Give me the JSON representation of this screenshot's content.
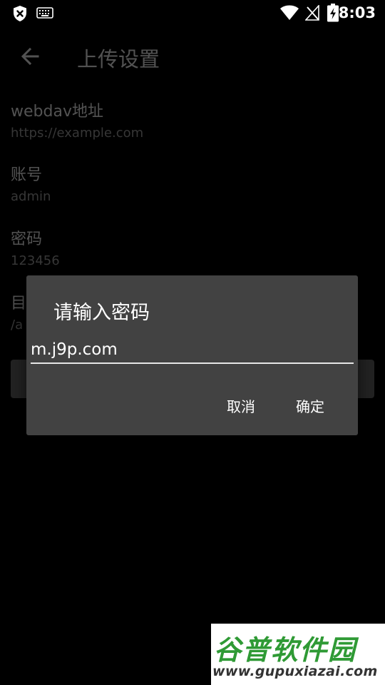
{
  "status_bar": {
    "time": "8:03",
    "icons": [
      "shield-x-icon",
      "keyboard-icon",
      "wifi-icon",
      "no-signal-icon",
      "battery-charging-icon"
    ]
  },
  "toolbar": {
    "back_icon": "arrow-left-icon",
    "title": "上传设置"
  },
  "settings": [
    {
      "label": "webdav地址",
      "value": "https://example.com"
    },
    {
      "label": "账号",
      "value": "admin"
    },
    {
      "label": "密码",
      "value": "123456"
    },
    {
      "label": "目",
      "value": "/a"
    }
  ],
  "dialog": {
    "title": "请输入密码",
    "input_value": "m.j9p.com",
    "cancel_label": "取消",
    "ok_label": "确定"
  },
  "watermark": {
    "line1": "谷普软件园",
    "line2": "www.gupuxiazai.com"
  },
  "colors": {
    "background": "#000000",
    "dialog_background": "#424242",
    "value_text": "#a8a8a8",
    "watermark_green": "#2f9a35"
  }
}
